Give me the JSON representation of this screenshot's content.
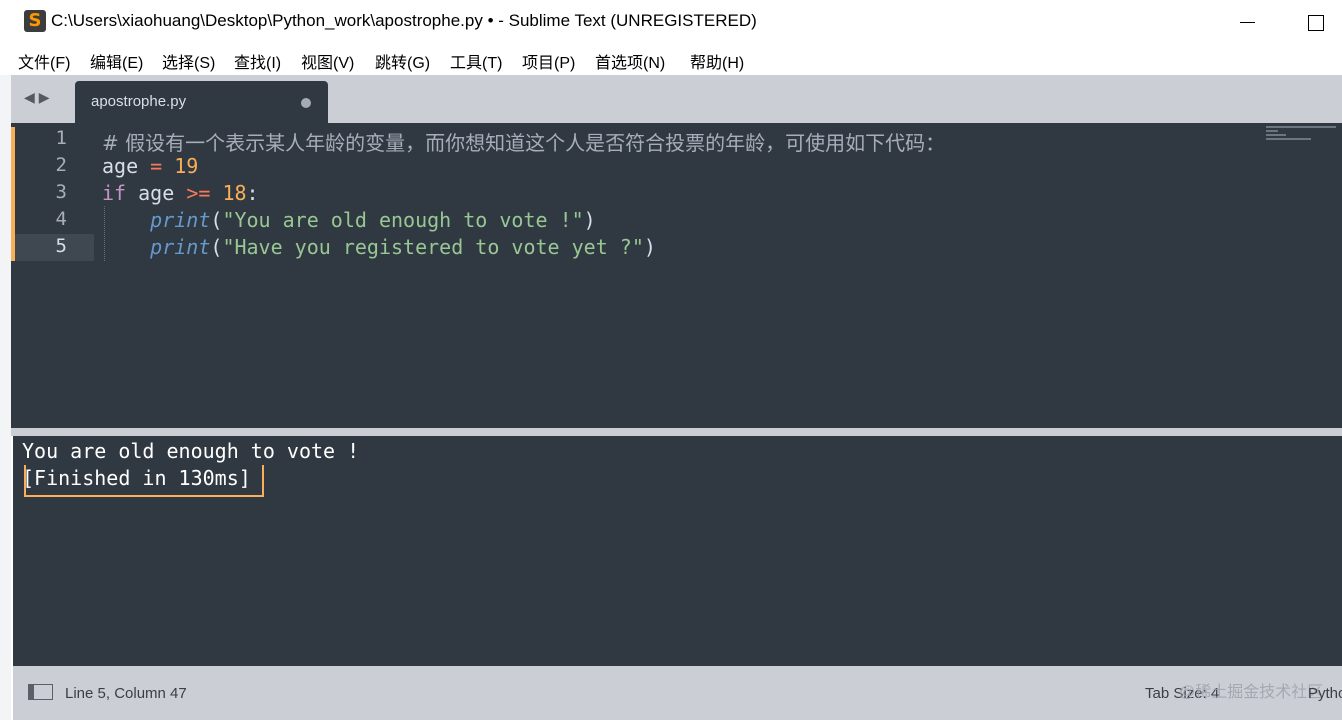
{
  "window": {
    "title": "C:\\Users\\xiaohuang\\Desktop\\Python_work\\apostrophe.py • - Sublime Text (UNREGISTERED)",
    "app_icon": "S"
  },
  "menu": [
    "文件(F)",
    "编辑(E)",
    "选择(S)",
    "查找(I)",
    "视图(V)",
    "跳转(G)",
    "工具(T)",
    "项目(P)",
    "首选项(N)",
    "帮助(H)"
  ],
  "tabs": [
    {
      "label": "apostrophe.py",
      "dirty": true,
      "active": true
    }
  ],
  "nav_arrows": "◀▶",
  "editor": {
    "line_numbers": [
      "1",
      "2",
      "3",
      "4",
      "5"
    ],
    "active_line": 5,
    "lines": [
      {
        "tokens": [
          {
            "t": "# 假设有一个表示某人年龄的变量，而你想知道这个人是否符合投票的年龄，可使用如下代码：",
            "c": "comment"
          }
        ]
      },
      {
        "tokens": [
          {
            "t": "age ",
            "c": "punc"
          },
          {
            "t": "=",
            "c": "op"
          },
          {
            "t": " ",
            "c": "punc"
          },
          {
            "t": "19",
            "c": "num"
          }
        ]
      },
      {
        "tokens": [
          {
            "t": "if",
            "c": "kw"
          },
          {
            "t": " age ",
            "c": "punc"
          },
          {
            "t": ">=",
            "c": "op"
          },
          {
            "t": " ",
            "c": "punc"
          },
          {
            "t": "18",
            "c": "num"
          },
          {
            "t": ":",
            "c": "punc"
          }
        ]
      },
      {
        "tokens": [
          {
            "t": "    ",
            "c": "punc"
          },
          {
            "t": "print",
            "c": "fn"
          },
          {
            "t": "(",
            "c": "punc"
          },
          {
            "t": "\"You are old enough to vote !\"",
            "c": "str"
          },
          {
            "t": ")",
            "c": "punc"
          }
        ]
      },
      {
        "tokens": [
          {
            "t": "    ",
            "c": "punc"
          },
          {
            "t": "print",
            "c": "fn"
          },
          {
            "t": "(",
            "c": "punc"
          },
          {
            "t": "\"Have you registered to vote yet ?\"",
            "c": "str"
          },
          {
            "t": ")",
            "c": "punc"
          }
        ]
      }
    ]
  },
  "output": {
    "lines": [
      "You are old enough to vote !",
      "[Finished in 130ms]"
    ]
  },
  "status": {
    "position": "Line 5, Column 47",
    "tab_size": "Tab Size: 4",
    "syntax": "Python",
    "watermark": "@稀土掘金技术社区"
  },
  "colors": {
    "editor_bg": "#303841",
    "comment": "#a7adba",
    "keyword": "#c594c5",
    "operator": "#f97b58",
    "number": "#f9ae58",
    "string": "#99c794",
    "function": "#6699cc",
    "accent": "#f9ae58"
  }
}
